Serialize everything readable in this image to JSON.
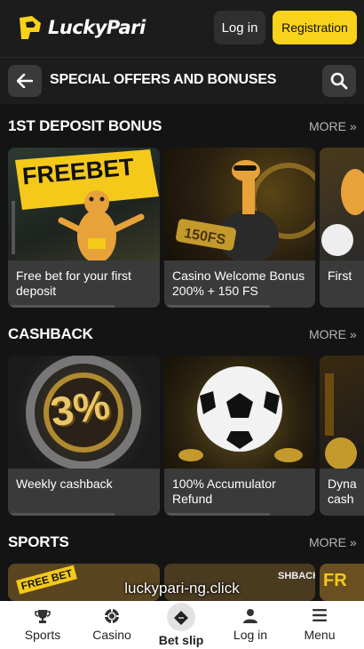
{
  "header": {
    "logo_text": "LuckyPari",
    "login_label": "Log in",
    "register_label": "Registration"
  },
  "subheader": {
    "title": "SPECIAL OFFERS AND BONUSES"
  },
  "sections": [
    {
      "title": "1ST DEPOSIT BONUS",
      "more": "MORE",
      "cards": [
        {
          "caption": "Free bet for your first deposit",
          "banner_text": "FREEBET"
        },
        {
          "caption": "Casino Welcome Bonus 200% + 150 FS",
          "banner_text": "150FS"
        },
        {
          "caption": "First"
        }
      ]
    },
    {
      "title": "CASHBACK",
      "more": "MORE",
      "cards": [
        {
          "caption": "Weekly cashback",
          "banner_text": "3%"
        },
        {
          "caption": "100% Accumulator Refund"
        },
        {
          "caption": "Dyna cash"
        }
      ]
    },
    {
      "title": "SPORTS",
      "more": "MORE",
      "cards": [
        {
          "banner_text": "FREE BET"
        },
        {
          "banner_text": "SHBACK"
        },
        {
          "banner_text": "FR"
        }
      ]
    }
  ],
  "watermark": "luckypari-ng.click",
  "bottom_nav": [
    {
      "label": "Sports",
      "icon": "trophy-icon"
    },
    {
      "label": "Casino",
      "icon": "chip-icon"
    },
    {
      "label": "Bet slip",
      "icon": "ticket-icon"
    },
    {
      "label": "Log in",
      "icon": "user-icon"
    },
    {
      "label": "Menu",
      "icon": "menu-icon"
    }
  ],
  "colors": {
    "accent": "#f9d21b",
    "background": "#141414",
    "panel": "#1c1c1c",
    "caption": "#3a3a3a"
  }
}
